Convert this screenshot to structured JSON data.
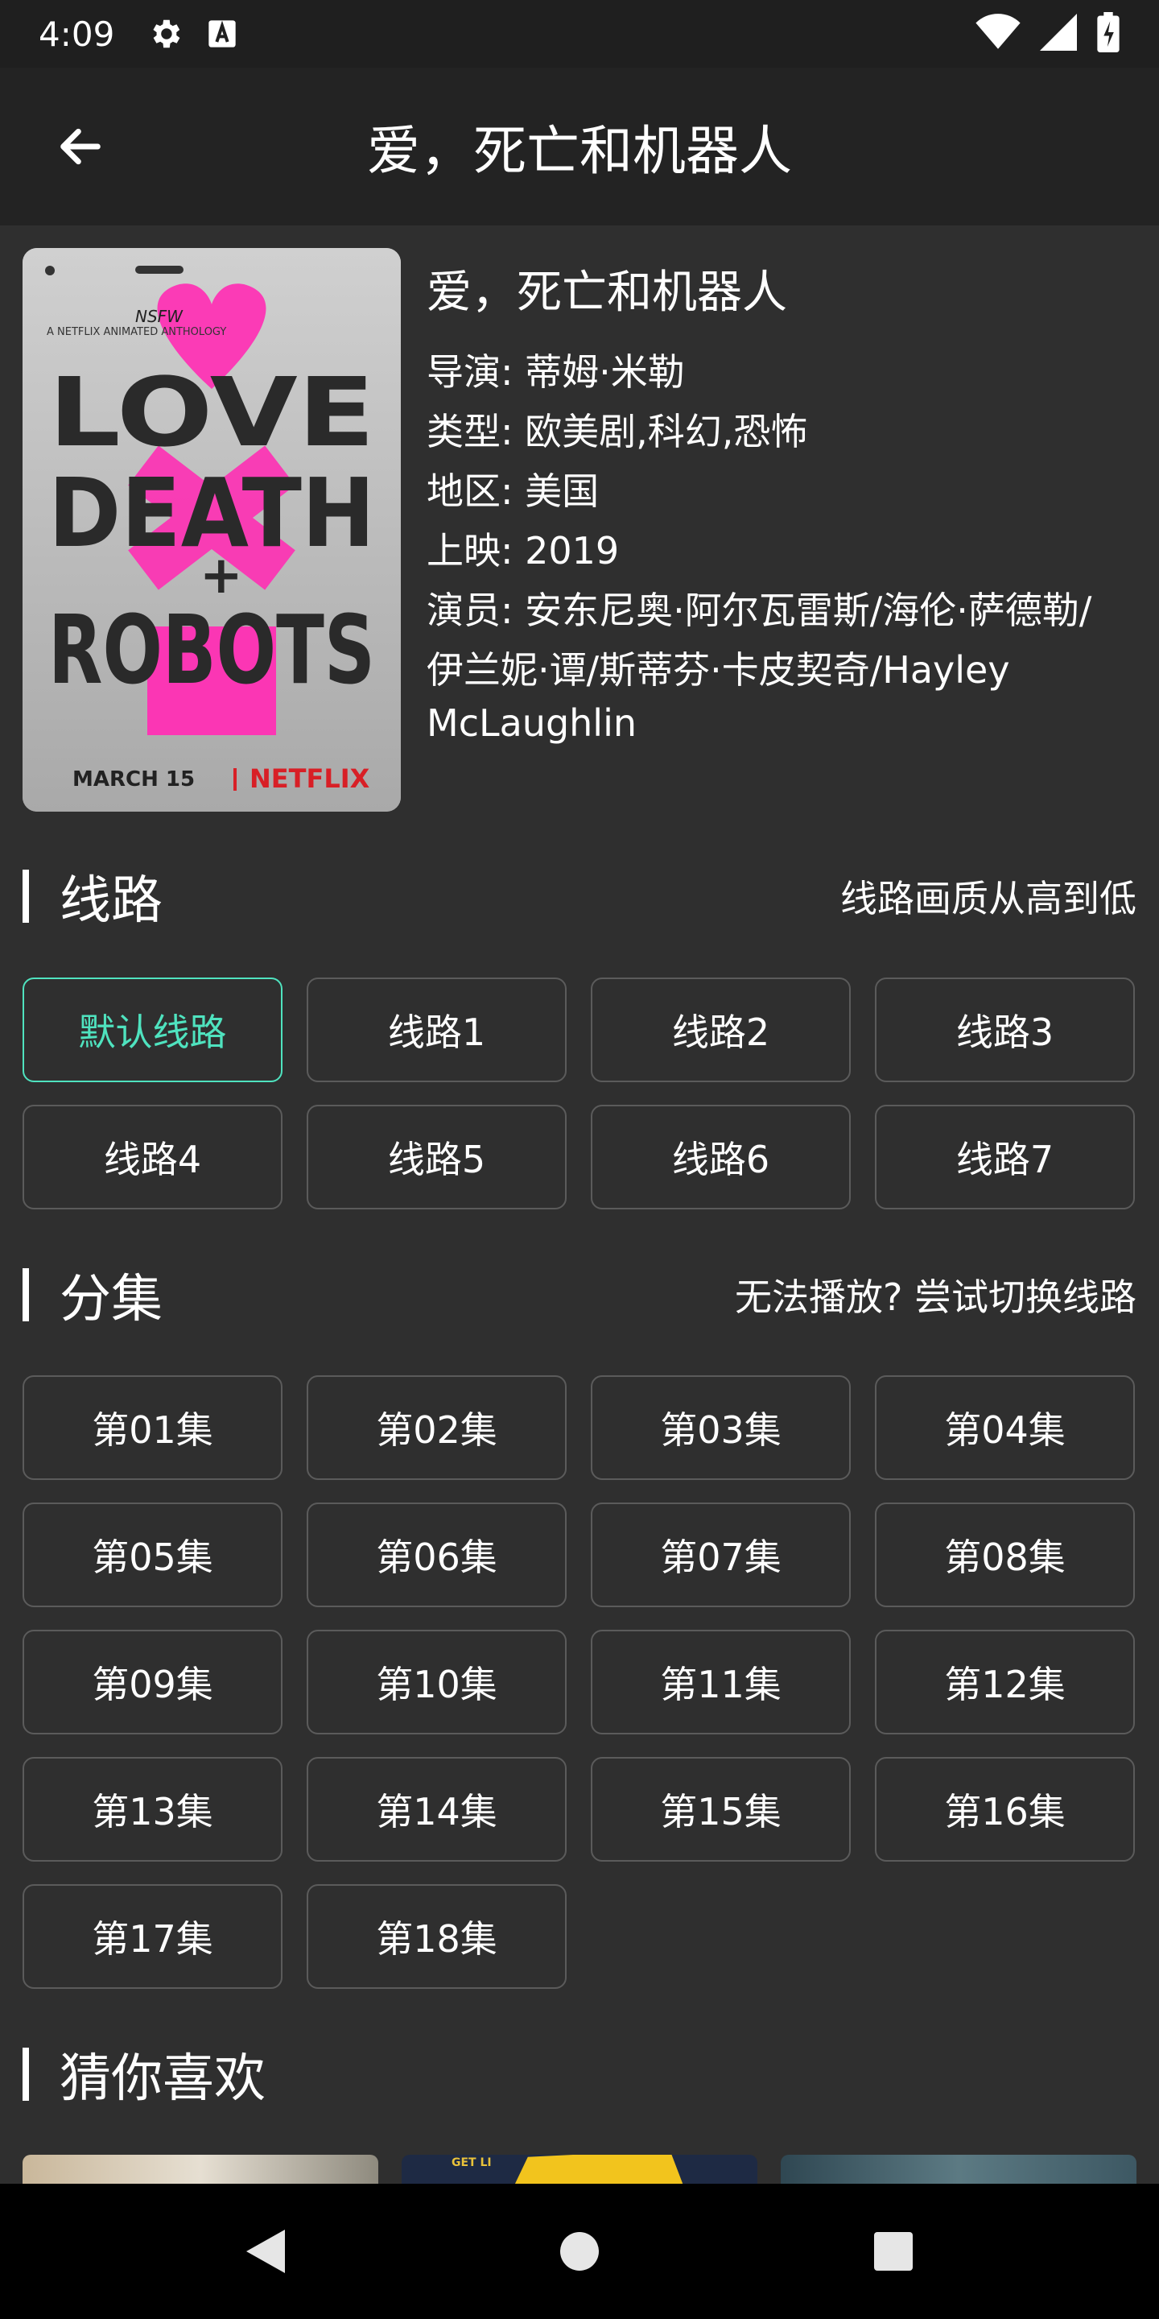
{
  "status_bar": {
    "time": "4:09",
    "icons_left": [
      "gear-icon",
      "text-a-icon"
    ],
    "icons_right": [
      "wifi-icon",
      "signal-icon",
      "battery-icon"
    ]
  },
  "app_bar": {
    "title": "爱，死亡和机器人",
    "back_icon": "arrow-left-icon"
  },
  "detail": {
    "poster": {
      "top_text": "NSFW",
      "subtitle": "A NETFLIX ANIMATED ANTHOLOGY",
      "line1": "LOVE",
      "line2": "DEATH",
      "plus": "+",
      "line3": "ROBOTS",
      "date": "MARCH 15",
      "brand": "NETFLIX"
    },
    "title": "爱，死亡和机器人",
    "director": "导演: 蒂姆·米勒",
    "genre": "类型: 欧美剧,科幻,恐怖",
    "region": "地区: 美国",
    "release": "上映: 2019",
    "cast_line1": "演员: 安东尼奥·阿尔瓦雷斯/海伦·萨德勒/",
    "cast_line2": "伊兰妮·谭/斯蒂芬·卡皮契奇/Hayley",
    "cast_line3": "McLaughlin"
  },
  "routes": {
    "title": "线路",
    "note": "线路画质从高到低",
    "items": [
      "默认线路",
      "线路1",
      "线路2",
      "线路3",
      "线路4",
      "线路5",
      "线路6",
      "线路7"
    ],
    "selected_index": 0
  },
  "episodes": {
    "title": "分集",
    "note": "无法播放? 尝试切换线路",
    "items": [
      "第01集",
      "第02集",
      "第03集",
      "第04集",
      "第05集",
      "第06集",
      "第07集",
      "第08集",
      "第09集",
      "第10集",
      "第11集",
      "第12集",
      "第13集",
      "第14集",
      "第15集",
      "第16集",
      "第17集",
      "第18集"
    ]
  },
  "recommend": {
    "title": "猜你喜欢",
    "card2_text": "GET LI"
  },
  "colors": {
    "accent": "#4fe3bf",
    "background": "#2f2f2f",
    "app_bar": "#232323",
    "poster_pink": "#ff2fb4",
    "netflix_red": "#d81f26"
  },
  "nav": {
    "icons": [
      "back-triangle-icon",
      "home-circle-icon",
      "recents-square-icon"
    ]
  }
}
